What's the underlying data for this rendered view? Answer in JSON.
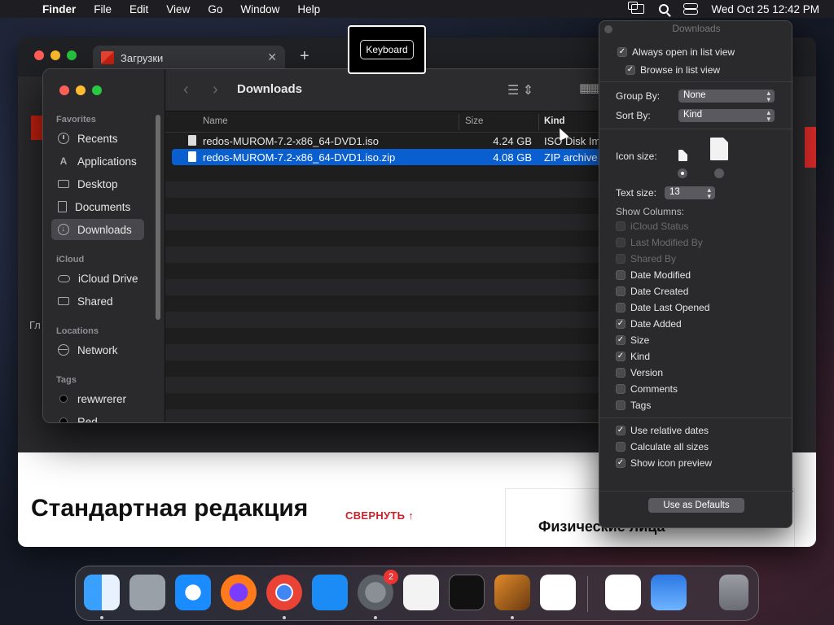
{
  "menubar": {
    "app": "Finder",
    "items": [
      "File",
      "Edit",
      "View",
      "Go",
      "Window",
      "Help"
    ],
    "clock": "Wed Oct 25  12:42 PM"
  },
  "browser": {
    "tab_title": "Загрузки",
    "side_text": "Гл",
    "page_title": "Стандартная редакция",
    "collapse_link": "СВЕРНУТЬ ↑",
    "card_title": "Физические лица"
  },
  "keyboard_hud": {
    "label": "Keyboard"
  },
  "finder": {
    "title": "Downloads",
    "sidebar": {
      "favorites_label": "Favorites",
      "favorites": [
        "Recents",
        "Applications",
        "Desktop",
        "Documents",
        "Downloads"
      ],
      "icloud_label": "iCloud",
      "icloud": [
        "iCloud Drive",
        "Shared"
      ],
      "locations_label": "Locations",
      "locations": [
        "Network"
      ],
      "tags_label": "Tags",
      "tags": [
        "rewwrerer",
        "Red"
      ]
    },
    "columns": {
      "name": "Name",
      "size": "Size",
      "kind": "Kind"
    },
    "files": [
      {
        "name": "redos-MUROM-7.2-x86_64-DVD1.iso",
        "size": "4.24 GB",
        "kind": "ISO Disk Im"
      },
      {
        "name": "redos-MUROM-7.2-x86_64-DVD1.iso.zip",
        "size": "4.08 GB",
        "kind": "ZIP archive"
      }
    ]
  },
  "view_options": {
    "title": "Downloads",
    "always_open": "Always open in list view",
    "browse": "Browse in list view",
    "group_by_label": "Group By:",
    "group_by_value": "None",
    "sort_by_label": "Sort By:",
    "sort_by_value": "Kind",
    "icon_size_label": "Icon size:",
    "text_size_label": "Text size:",
    "text_size_value": "13",
    "show_columns_label": "Show Columns:",
    "columns": [
      {
        "label": "iCloud Status",
        "checked": false,
        "disabled": true
      },
      {
        "label": "Last Modified By",
        "checked": false,
        "disabled": true
      },
      {
        "label": "Shared By",
        "checked": false,
        "disabled": true
      },
      {
        "label": "Date Modified",
        "checked": false,
        "disabled": false
      },
      {
        "label": "Date Created",
        "checked": false,
        "disabled": false
      },
      {
        "label": "Date Last Opened",
        "checked": false,
        "disabled": false
      },
      {
        "label": "Date Added",
        "checked": true,
        "disabled": false
      },
      {
        "label": "Size",
        "checked": true,
        "disabled": false
      },
      {
        "label": "Kind",
        "checked": true,
        "disabled": false
      },
      {
        "label": "Version",
        "checked": false,
        "disabled": false
      },
      {
        "label": "Comments",
        "checked": false,
        "disabled": false
      },
      {
        "label": "Tags",
        "checked": false,
        "disabled": false
      }
    ],
    "use_relative_dates": "Use relative dates",
    "calculate_sizes": "Calculate all sizes",
    "show_icon_preview": "Show icon preview",
    "defaults_button": "Use as Defaults"
  },
  "dock": {
    "settings_badge": "2",
    "apps": [
      "finder-icon",
      "launchpad-icon",
      "safari-icon",
      "firefox-icon",
      "chrome-icon",
      "app-store-icon",
      "system-settings-icon",
      "textedit-icon",
      "terminal-icon",
      "garageband-icon",
      "vscode-icon",
      "visual-studio-icon",
      "weather-icon",
      "trash-icon"
    ]
  }
}
